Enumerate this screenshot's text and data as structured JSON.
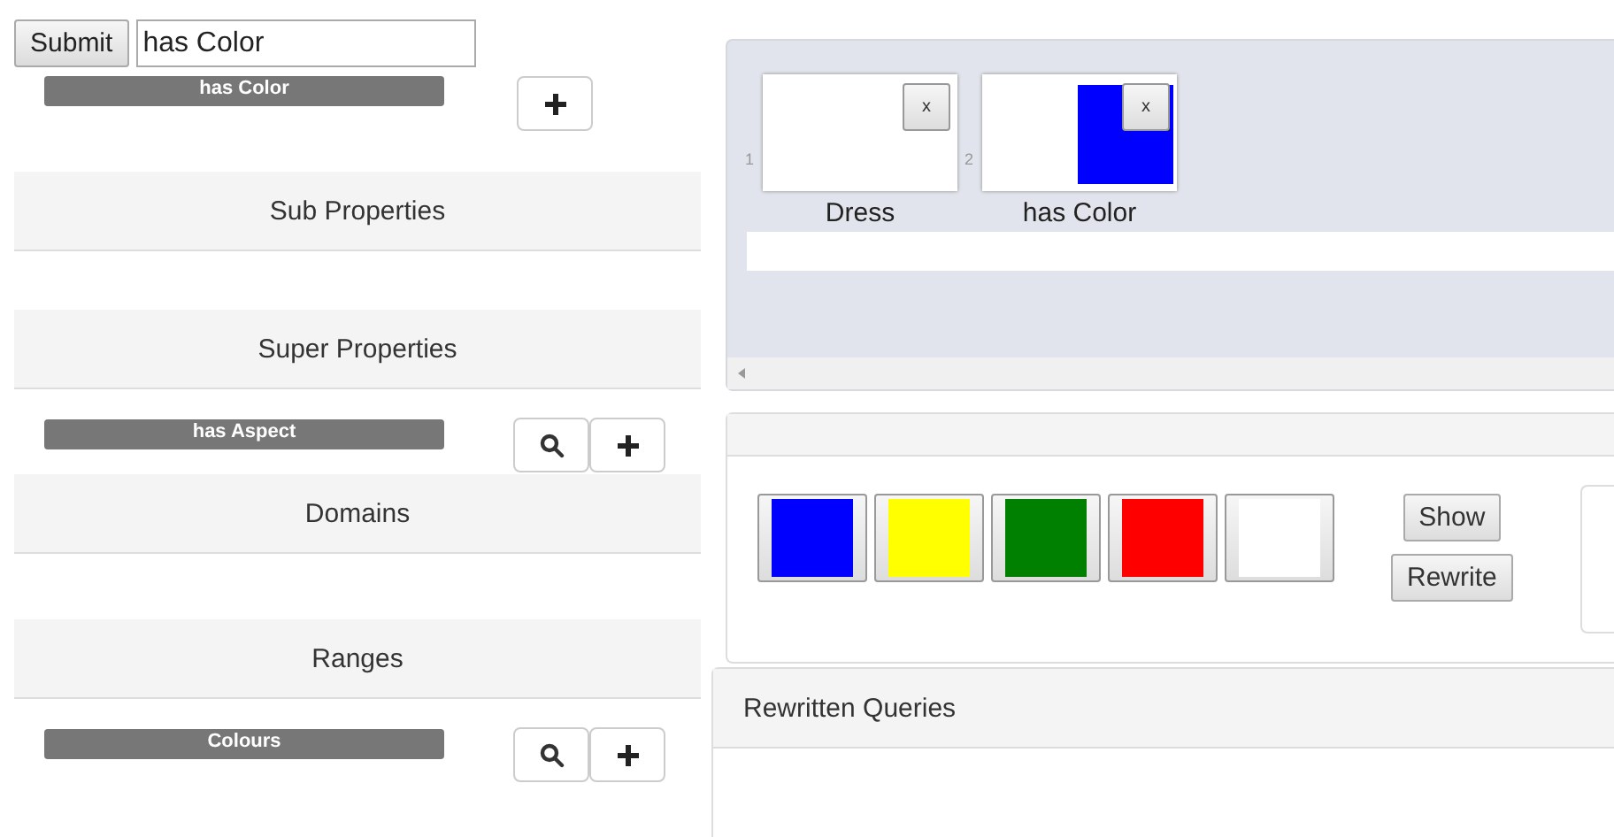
{
  "form": {
    "submit": "Submit",
    "query": "has Color"
  },
  "property_tag": {
    "label": "has Color"
  },
  "sections": [
    {
      "title": "Sub Properties"
    },
    {
      "title": "Super Properties",
      "items": [
        {
          "label": "has Aspect"
        }
      ]
    },
    {
      "title": "Domains"
    },
    {
      "title": "Ranges",
      "items": [
        {
          "label": "Colours"
        }
      ]
    }
  ],
  "path": {
    "nodes": [
      {
        "number": "1",
        "label": "Dress",
        "close": "x"
      },
      {
        "number": "2",
        "label": "has Color",
        "close": "x",
        "color": "#0000ff"
      }
    ]
  },
  "swatches": [
    {
      "color": "#0000ff"
    },
    {
      "color": "#ffff00"
    },
    {
      "color": "#008000"
    },
    {
      "color": "#ff0000"
    },
    {
      "color": "#ffffff"
    }
  ],
  "actions": [
    "Show",
    "Rewrite"
  ],
  "rewritten": {
    "title": "Rewritten Queries"
  }
}
